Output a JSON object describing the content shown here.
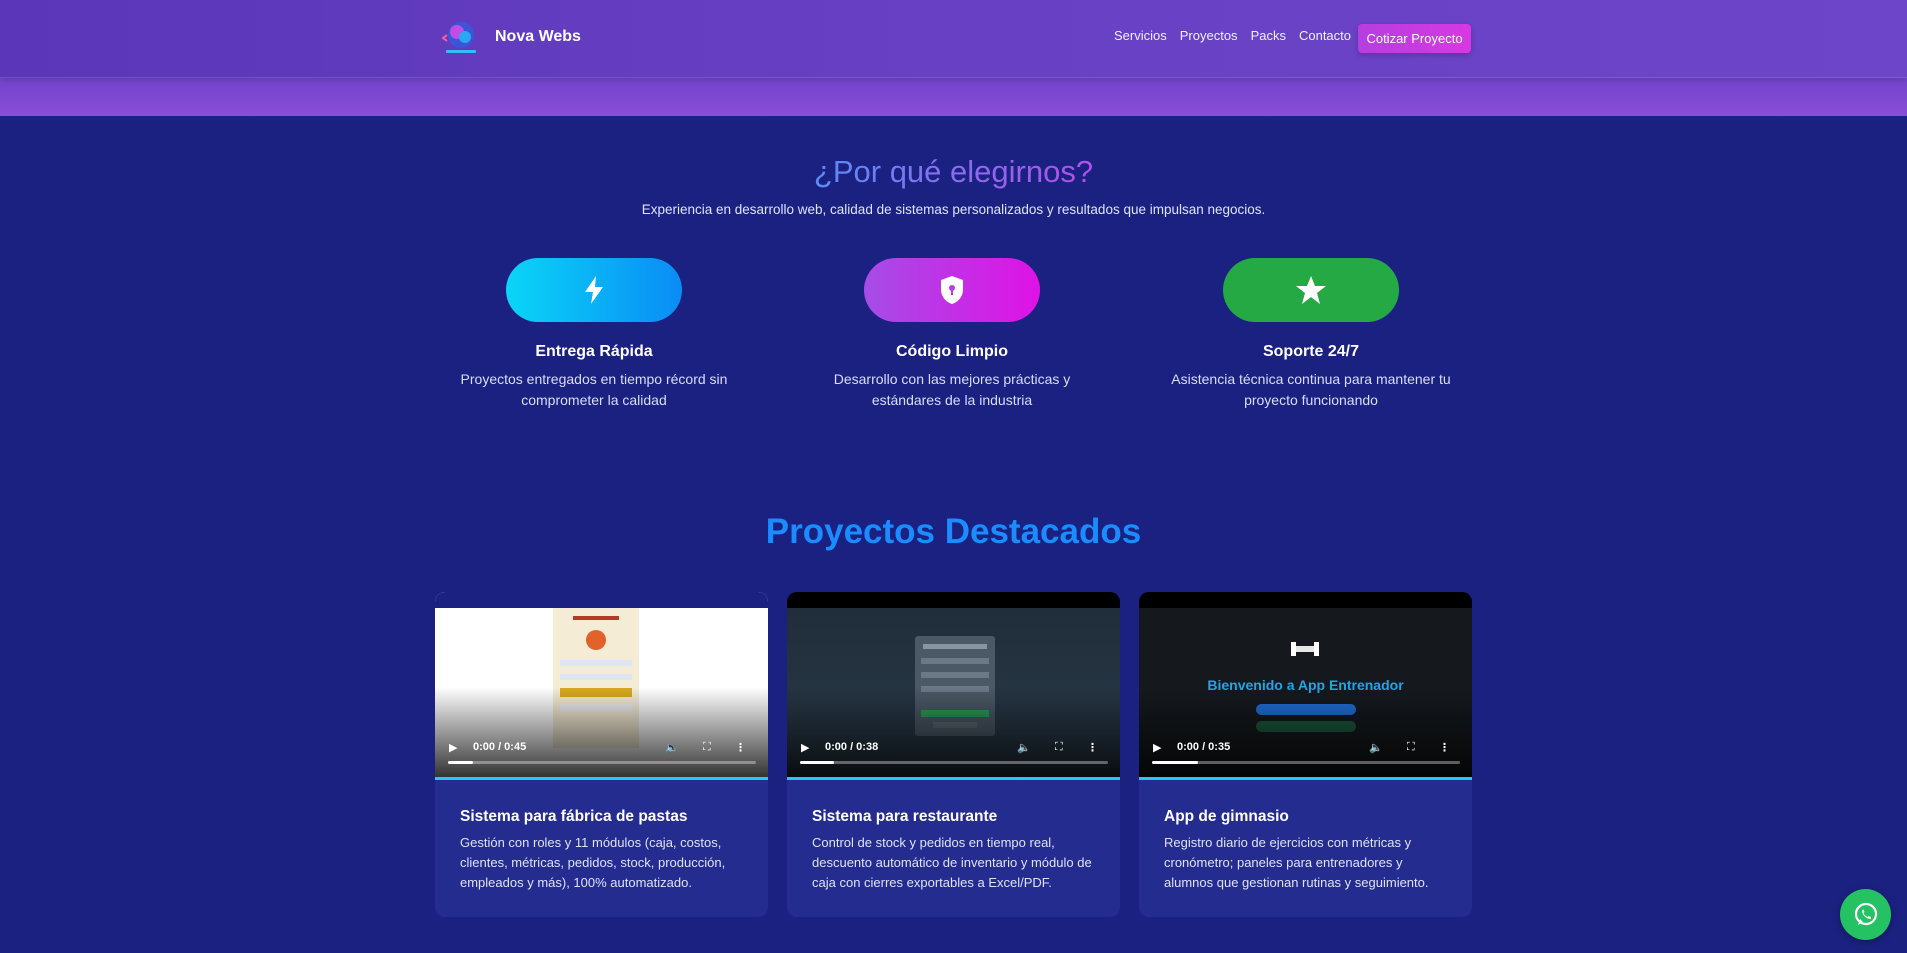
{
  "nav": {
    "brand": "Nova Webs",
    "links": [
      "Servicios",
      "Proyectos",
      "Packs",
      "Contacto"
    ],
    "cta": "Cotizar Proyecto"
  },
  "why": {
    "title": "¿Por qué elegirnos?",
    "subtitle": "Experiencia en desarrollo web, calidad de sistemas personalizados y resultados que impulsan negocios.",
    "features": [
      {
        "icon": "lightning-icon",
        "title": "Entrega Rápida",
        "desc": "Proyectos entregados en tiempo récord sin comprometer la calidad",
        "color": "#0ad5f7"
      },
      {
        "icon": "shield-lock-icon",
        "title": "Código Limpio",
        "desc": "Desarrollo con las mejores prácticas y estándares de la industria",
        "color": "#b246e6"
      },
      {
        "icon": "star-icon",
        "title": "Soporte 24/7",
        "desc": "Asistencia técnica continua para mantener tu proyecto funcionando",
        "color": "#25a944"
      }
    ]
  },
  "projects": {
    "title": "Proyectos Destacados",
    "items": [
      {
        "title": "Sistema para fábrica de pastas",
        "desc": "Gestión con roles y 11 módulos (caja, costos, clientes, métricas, pedidos, stock, producción, empleados y más), 100% automatizado.",
        "time": "0:00 / 0:45",
        "progress": 0.08
      },
      {
        "title": "Sistema para restaurante",
        "desc": "Control de stock y pedidos en tiempo real, descuento automático de inventario y módulo de caja con cierres exportables a Excel/PDF.",
        "time": "0:00 / 0:38",
        "progress": 0.11
      },
      {
        "title": "App de gimnasio",
        "desc": "Registro diario de ejercicios con métricas y cronómetro; paneles para entrenadores y alumnos que gestionan rutinas y seguimiento.",
        "time": "0:00 / 0:35",
        "progress": 0.15,
        "screen_heading": "Bienvenido a App Entrenador"
      }
    ]
  }
}
